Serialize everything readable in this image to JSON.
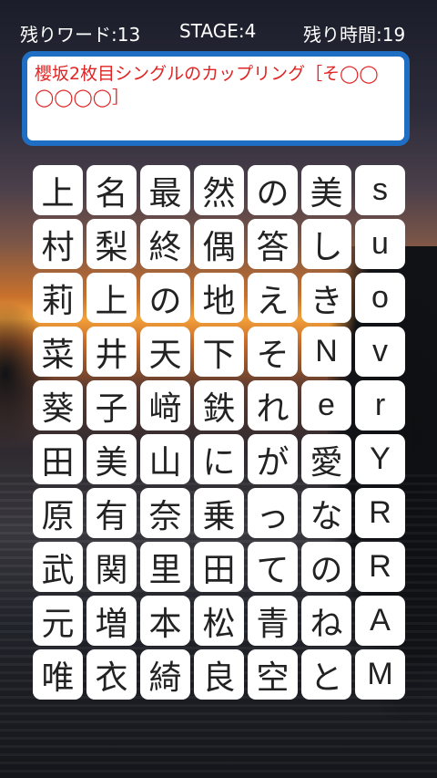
{
  "header": {
    "remaining_words": "残りワード:13",
    "stage": "STAGE:4",
    "remaining_time": "残り時間:19"
  },
  "question": {
    "text": "櫻坂2枚目シングルのカップリング［そ◯◯◯◯◯◯］"
  },
  "grid": {
    "columns": 7,
    "rows": [
      [
        "上",
        "名",
        "最",
        "然",
        "の",
        "美",
        "s"
      ],
      [
        "村",
        "梨",
        "終",
        "偶",
        "答",
        "し",
        "u"
      ],
      [
        "莉",
        "上",
        "の",
        "地",
        "え",
        "き",
        "o"
      ],
      [
        "菜",
        "井",
        "天",
        "下",
        "そ",
        "N",
        "v"
      ],
      [
        "葵",
        "子",
        "﨑",
        "鉄",
        "れ",
        "e",
        "r"
      ],
      [
        "田",
        "美",
        "山",
        "に",
        "が",
        "愛",
        "Y"
      ],
      [
        "原",
        "有",
        "奈",
        "乗",
        "っ",
        "な",
        "R"
      ],
      [
        "武",
        "関",
        "里",
        "田",
        "て",
        "の",
        "R"
      ],
      [
        "元",
        "増",
        "本",
        "松",
        "青",
        "ね",
        "A"
      ],
      [
        "唯",
        "衣",
        "綺",
        "良",
        "空",
        "と",
        "M"
      ]
    ]
  }
}
